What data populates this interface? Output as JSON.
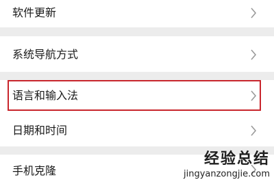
{
  "settings": {
    "items": [
      {
        "label": "软件更新",
        "icon": "chevron-right-icon"
      },
      {
        "label": "系统导航方式",
        "icon": "chevron-right-icon"
      },
      {
        "label": "语言和输入法",
        "icon": "chevron-right-icon",
        "highlighted": true
      },
      {
        "label": "日期和时间",
        "icon": "chevron-right-icon"
      },
      {
        "label": "手机克隆",
        "icon": "chevron-right-icon"
      }
    ]
  },
  "highlight": {
    "color": "#c8242b"
  },
  "watermark": {
    "title": "经验总结",
    "url": "jingyanzongjie.com"
  }
}
